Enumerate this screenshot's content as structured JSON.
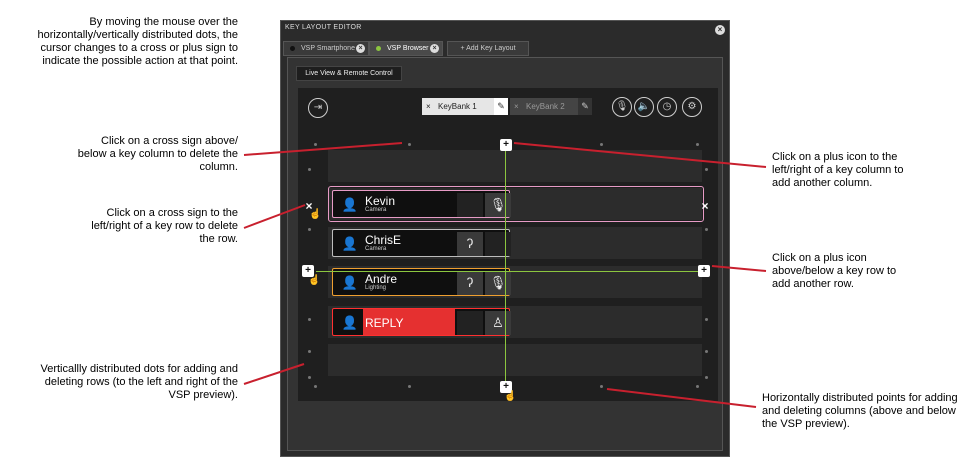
{
  "annotations": {
    "mouse_over": "By moving the mouse over the horizontally/vertically distributed dots, the cursor changes to a cross or plus sign to indicate the possible action at that point.",
    "delete_column": "Click on a cross sign above/ below a key column to delete the column.",
    "delete_row": "Click on a cross sign to the left/right of a key row to delete the row.",
    "vertical_dots": "Verticallly distributed dots for adding and deleting rows (to the left and right of the VSP preview).",
    "add_column": "Click on a plus icon to the left/right of a key column to add another column.",
    "add_row": "Click on a plus icon above/below a key row to add another row.",
    "horizontal_points": "Horizontally distributed points for adding and deleting columns (above and below the VSP preview)."
  },
  "window": {
    "title": "KEY LAYOUT EDITOR",
    "tabs": [
      {
        "label": "VSP Smartphone",
        "status_color": "#1a1a1a"
      },
      {
        "label": "VSP Browser",
        "status_color": "#8cc63f"
      },
      {
        "label": "+ Add Key Layout"
      }
    ],
    "subtab": "Live View & Remote Control",
    "keybanks": [
      {
        "label": "KeyBank 1",
        "active": true
      },
      {
        "label": "KeyBank 2",
        "active": false
      }
    ]
  },
  "icons": [
    "login-icon",
    "microphone-icon",
    "speaker-icon",
    "clock-icon",
    "settings-icon"
  ],
  "keys": [
    {
      "name": "Kevin",
      "role": "Camera",
      "action_icon": "microphone-icon",
      "border": "#e79bc6"
    },
    {
      "name": "ChrisE",
      "role": "Camera",
      "action_icon": "ear-icon",
      "border": "#bdbdbd"
    },
    {
      "name": "Andre",
      "role": "Lighting",
      "action_icon": "ear-icon",
      "action_icon_2": "microphone-icon",
      "border": "#f0a030"
    },
    {
      "name": "REPLY",
      "role": "",
      "action_icon": "user-icon",
      "border": "#ff3030",
      "fill": "#e53030"
    }
  ],
  "colors": {
    "callout": "#c8202e",
    "crosshair": "#8cc63f",
    "reply": "#e53030",
    "selected_row": "#e79bc6"
  }
}
